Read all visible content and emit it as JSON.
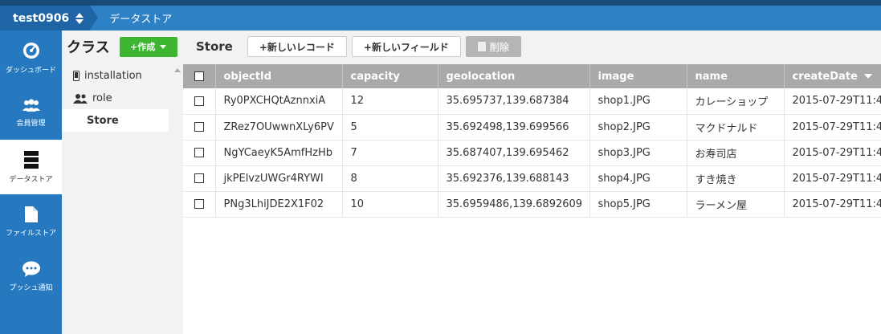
{
  "app": {
    "name": "test0906",
    "breadcrumb": "データストア"
  },
  "nav": [
    {
      "label": "ダッシュボード",
      "icon": "dashboard-icon"
    },
    {
      "label": "会員管理",
      "icon": "users-icon"
    },
    {
      "label": "データストア",
      "icon": "database-icon",
      "active": true
    },
    {
      "label": "ファイルストア",
      "icon": "file-icon"
    },
    {
      "label": "プッシュ通知",
      "icon": "chat-icon"
    }
  ],
  "classes": {
    "title": "クラス",
    "create_label": "+作成",
    "items": [
      {
        "label": "installation",
        "icon": "mobile-icon"
      },
      {
        "label": "role",
        "icon": "users-icon"
      },
      {
        "label": "Store",
        "active": true
      }
    ]
  },
  "toolbar": {
    "title": "Store",
    "new_record": "+新しいレコード",
    "new_field": "+新しいフィールド",
    "delete": "削除"
  },
  "table": {
    "columns": [
      "objectId",
      "capacity",
      "geolocation",
      "image",
      "name",
      "createDate"
    ],
    "rows": [
      [
        "Ry0PXCHQtAznnxiA",
        "12",
        "35.695737,139.687384",
        "shop1.JPG",
        "カレーショップ",
        "2015-07-29T11:4"
      ],
      [
        "ZRez7OUwwnXLy6PV",
        "5",
        "35.692498,139.699566",
        "shop2.JPG",
        "マクドナルド",
        "2015-07-29T11:4"
      ],
      [
        "NgYCaeyK5AmfHzHb",
        "7",
        "35.687407,139.695462",
        "shop3.JPG",
        "お寿司店",
        "2015-07-29T11:4"
      ],
      [
        "jkPElvzUWGr4RYWI",
        "8",
        "35.692376,139.688143",
        "shop4.JPG",
        "すき焼き",
        "2015-07-29T11:4"
      ],
      [
        "PNg3LhiJDE2X1F02",
        "10",
        "35.6959486,139.6892609",
        "shop5.JPG",
        "ラーメン屋",
        "2015-07-29T11:4"
      ]
    ]
  },
  "colors": {
    "topbar": "#2f81c5",
    "nav": "#2679be",
    "create": "#3cb531",
    "header": "#a9a9a9"
  }
}
